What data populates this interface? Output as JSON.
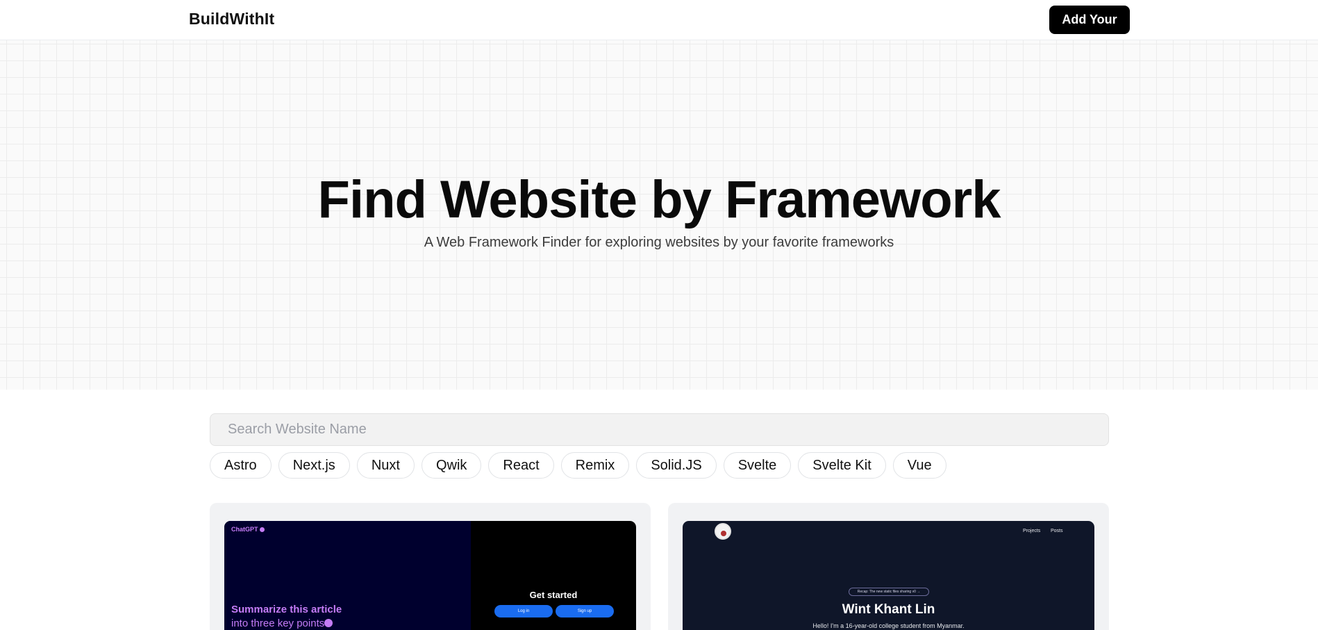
{
  "header": {
    "logo": "BuildWithIt",
    "add_button": "Add Your"
  },
  "hero": {
    "title": "Find Website by Framework",
    "subtitle": "A Web Framework Finder for exploring websites by your favorite frameworks"
  },
  "search": {
    "placeholder": "Search Website Name",
    "value": ""
  },
  "filters": [
    "Astro",
    "Next.js",
    "Nuxt",
    "Qwik",
    "React",
    "Remix",
    "Solid.JS",
    "Svelte",
    "Svelte Kit",
    "Vue"
  ],
  "cards": [
    {
      "brand": "ChatGPT",
      "headline": "Summarize this article",
      "subline": "into three key points",
      "cta_title": "Get started",
      "login_label": "Log in",
      "signup_label": "Sign up"
    },
    {
      "nav": [
        "Projects",
        "Posts"
      ],
      "pill": "Recap: The new static files sharing v0 →",
      "name": "Wint Khant Lin",
      "bio": "Hello! I'm a 16-year-old college student from Myanmar."
    }
  ],
  "colors": {
    "accent": "#000000",
    "chatgpt_purple": "#c47cf5",
    "chatgpt_blue": "#1a6cf0",
    "card_bg": "#f1f2f4",
    "dark_navy": "#0f1629"
  }
}
